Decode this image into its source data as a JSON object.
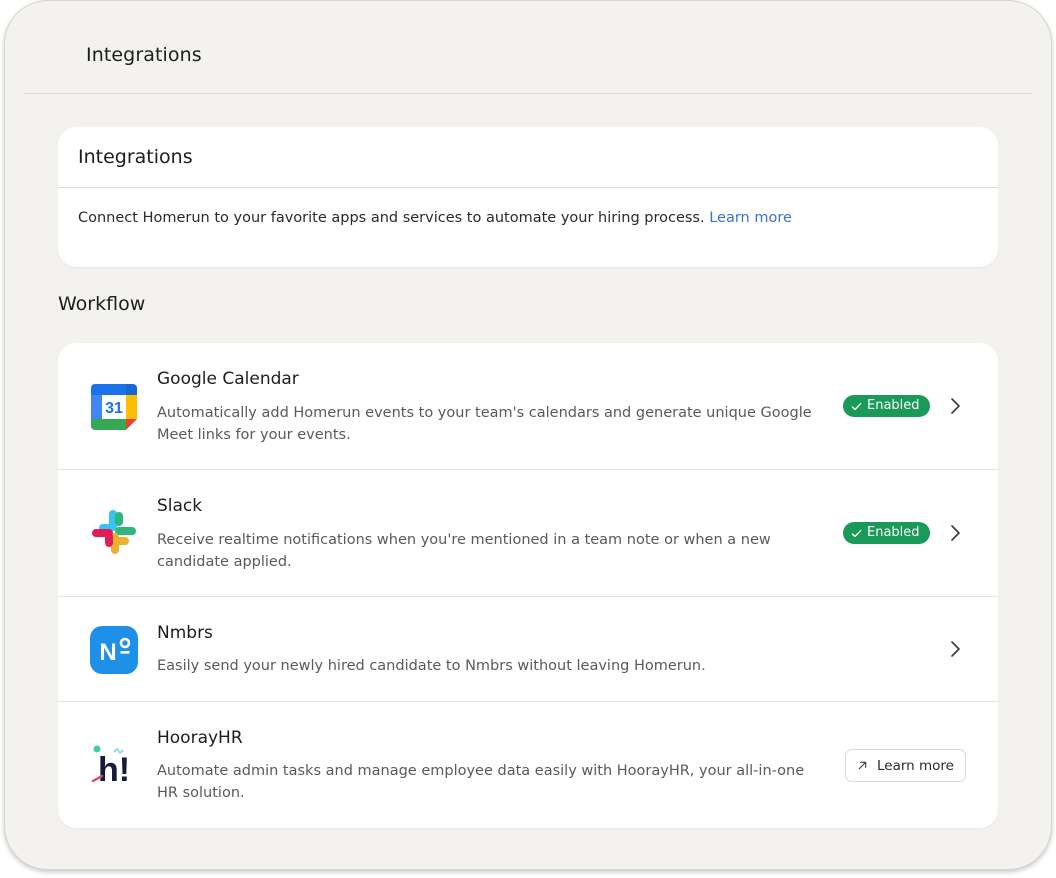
{
  "header": {
    "title": "Integrations"
  },
  "intro": {
    "title": "Integrations",
    "description": "Connect Homerun to your favorite apps and services to automate your hiring process.",
    "link_label": "Learn more"
  },
  "workflow": {
    "title": "Workflow",
    "items": [
      {
        "name": "Google Calendar",
        "description": "Automatically add Homerun events to your team's calendars and generate unique Google Meet links for your events.",
        "status": "Enabled",
        "icon": "google-calendar-icon",
        "icon_text": "31"
      },
      {
        "name": "Slack",
        "description": "Receive realtime notifications when you're mentioned in a team note or when a new candidate applied.",
        "status": "Enabled",
        "icon": "slack-icon"
      },
      {
        "name": "Nmbrs",
        "description": "Easily send your newly hired candidate to Nmbrs without leaving Homerun.",
        "icon": "nmbrs-icon",
        "icon_text": "N"
      },
      {
        "name": "HoorayHR",
        "description": "Automate admin tasks and manage employee data easily with HoorayHR, your all-in-one HR solution.",
        "button_label": "Learn more",
        "icon": "hoorayhr-icon",
        "icon_text": "h!"
      }
    ]
  },
  "colors": {
    "background": "#f3f2ee",
    "card": "#ffffff",
    "enabled_badge": "#1a9959",
    "link": "#3a73d6",
    "nmbrs_blue": "#1e90e8"
  }
}
